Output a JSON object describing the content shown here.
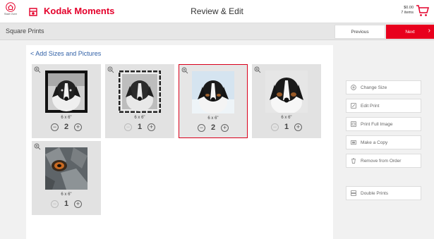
{
  "header": {
    "home_label": "Start Over",
    "brand": "Kodak Moments",
    "title": "Review & Edit",
    "cart_amount": "$0.00",
    "cart_items": "7 items"
  },
  "subheader": {
    "product": "Square Prints",
    "previous": "Previous",
    "next": "Next"
  },
  "panel": {
    "back_link": "< Add Sizes and Pictures"
  },
  "prints": [
    {
      "size": "6 x 6\"",
      "qty": "2",
      "selected": false
    },
    {
      "size": "6 x 6\"",
      "qty": "1",
      "selected": false
    },
    {
      "size": "6 x 6\"",
      "qty": "2",
      "selected": true
    },
    {
      "size": "6 x 6\"",
      "qty": "1",
      "selected": false
    },
    {
      "size": "6 x 6\"",
      "qty": "1",
      "selected": false
    }
  ],
  "actions": {
    "change_size": "Change Size",
    "edit_print": "Edit Print",
    "print_full": "Print Full Image",
    "make_copy": "Make a Copy",
    "remove": "Remove from Order",
    "double": "Double Prints"
  },
  "colors": {
    "brand_red": "#e4002b",
    "next_red": "#e8001d",
    "link_blue": "#2f5fa6"
  }
}
